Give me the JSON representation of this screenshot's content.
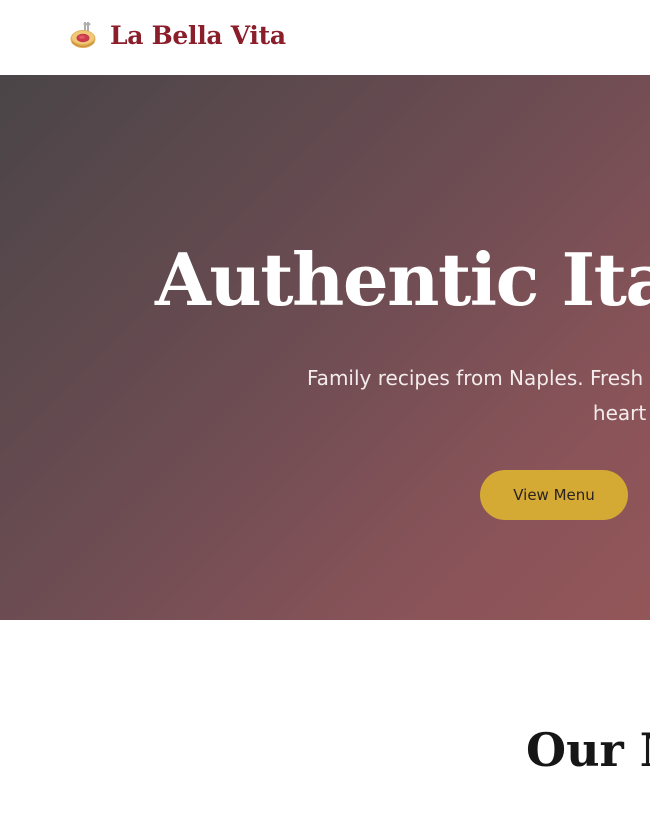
{
  "header": {
    "brand_name": "La Bella Vita",
    "brand_icon": "spaghetti-bowl-icon"
  },
  "hero": {
    "title": "Authentic Italian",
    "subtitle": "Family recipes from Naples. Fresh ingredients and warm hospitality in the heart of the city.",
    "cta_label": "View Menu"
  },
  "menu_section": {
    "title": "Our Menu"
  },
  "colors": {
    "brand": "#8b1e2b",
    "accent": "#d4aa34",
    "hero_start": "#4a4548",
    "hero_end": "#935659"
  }
}
